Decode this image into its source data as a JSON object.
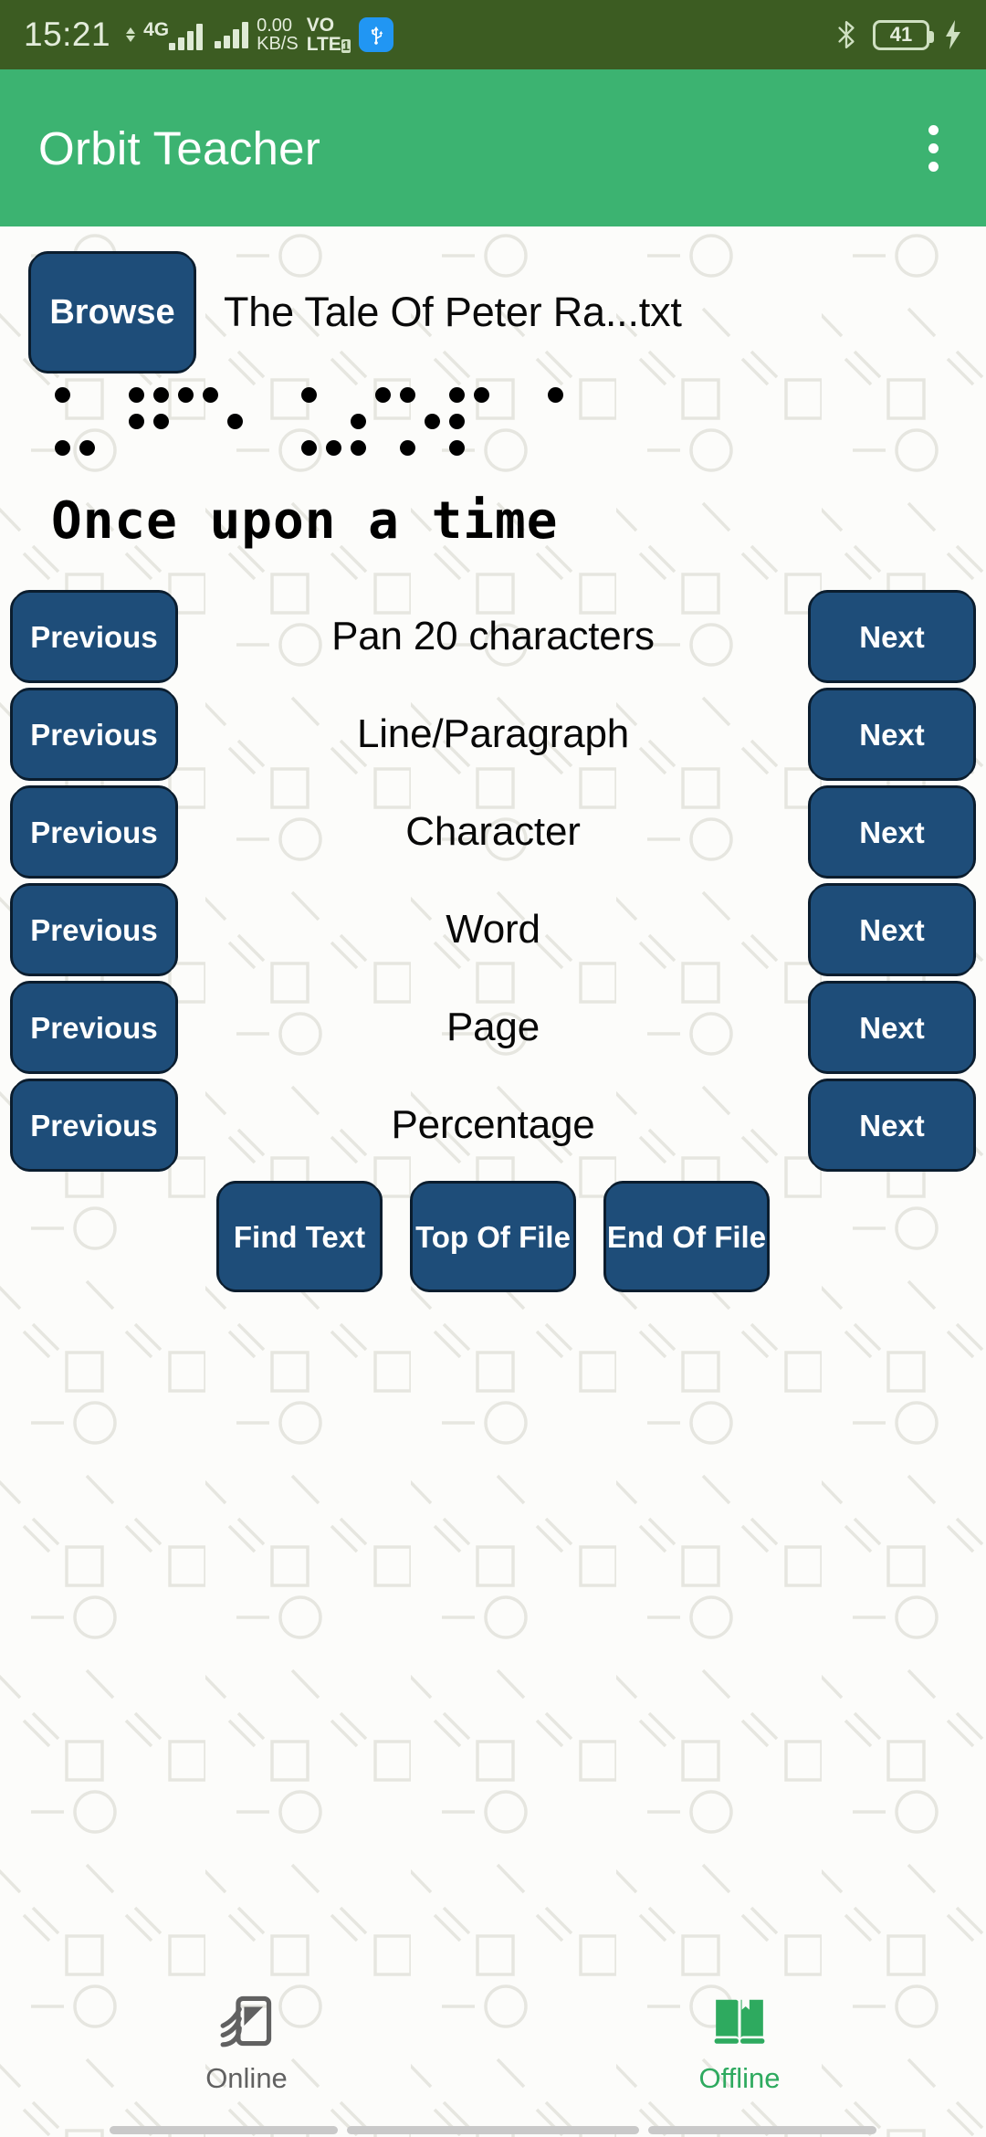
{
  "status_bar": {
    "time": "15:21",
    "network_type": "4G",
    "data_rate_value": "0.00",
    "data_rate_unit": "KB/S",
    "volte_top": "VO",
    "volte_bottom": "LTE",
    "volte_sim": "1",
    "usb_icon": "usb-icon",
    "bluetooth_icon": "bluetooth-icon",
    "battery_level": "41",
    "charging_icon": "charging-bolt-icon",
    "background_color": "#3c5c22"
  },
  "app_bar": {
    "title": "Orbit Teacher",
    "overflow_icon": "more-vert-icon",
    "background_color": "#3cb371"
  },
  "file_row": {
    "browse_label": "Browse",
    "file_name": "The Tale Of Peter Ra...txt"
  },
  "braille": {
    "cells": [
      [
        1,
        0,
        1,
        0,
        0,
        1
      ],
      [
        0,
        0,
        0,
        1,
        1,
        0
      ],
      [
        1,
        1,
        0,
        1,
        0,
        0
      ],
      [
        1,
        0,
        0,
        0,
        1,
        0
      ],
      [
        0,
        0,
        0,
        0,
        0,
        0
      ],
      [
        1,
        0,
        1,
        0,
        0,
        1
      ],
      [
        0,
        1,
        1,
        1,
        0,
        0
      ],
      [
        1,
        0,
        1,
        0,
        1,
        0
      ],
      [
        1,
        1,
        1,
        1,
        0,
        0
      ],
      [
        0,
        0,
        0,
        0,
        0,
        0
      ],
      [
        1,
        0,
        0,
        0,
        0,
        0
      ]
    ]
  },
  "text_display": {
    "line": "Once upon a time"
  },
  "navigation": {
    "previous_label": "Previous",
    "next_label": "Next",
    "rows": [
      {
        "label": "Pan 20 characters"
      },
      {
        "label": "Line/Paragraph"
      },
      {
        "label": "Character"
      },
      {
        "label": "Word"
      },
      {
        "label": "Page"
      },
      {
        "label": "Percentage"
      }
    ]
  },
  "actions": [
    {
      "label": "Find Text",
      "name": "find-text-button"
    },
    {
      "label": "Top Of File",
      "name": "top-of-file-button"
    },
    {
      "label": "End Of File",
      "name": "end-of-file-button"
    }
  ],
  "bottom_nav": {
    "items": [
      {
        "label": "Online",
        "icon": "cast-screen-icon",
        "active": false,
        "color": "#616161"
      },
      {
        "label": "Offline",
        "icon": "open-book-icon",
        "active": true,
        "color": "#2eaa5f"
      }
    ]
  },
  "theme": {
    "button_color": "#1e4d79",
    "button_border": "#0b1d2e",
    "accent_green": "#3cb371",
    "status_green": "#3c5c22"
  }
}
